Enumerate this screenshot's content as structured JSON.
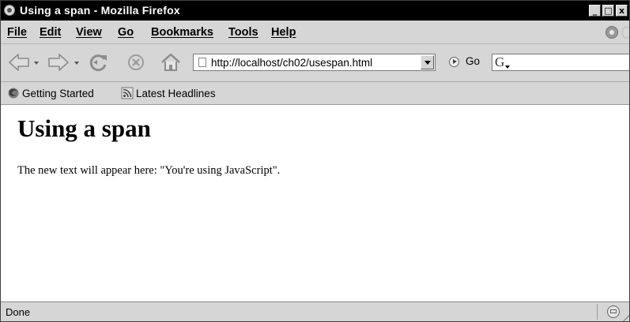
{
  "window": {
    "title": "Using a span - Mozilla Firefox",
    "controls": {
      "minimize": "_",
      "maximize": "□",
      "close": "x"
    }
  },
  "menubar": {
    "items": [
      {
        "label": "File"
      },
      {
        "label": "Edit"
      },
      {
        "label": "View"
      },
      {
        "label": "Go"
      },
      {
        "label": "Bookmarks"
      },
      {
        "label": "Tools"
      },
      {
        "label": "Help"
      }
    ]
  },
  "navbar": {
    "buttons": [
      "back-icon",
      "forward-icon",
      "reload-icon",
      "stop-icon",
      "home-icon"
    ],
    "url": "http://localhost/ch02/usespan.html",
    "go_label": "Go",
    "search_engine_icon": "google-icon",
    "search_value": ""
  },
  "bookmarks": {
    "items": [
      {
        "label": "Getting Started",
        "icon": "firefox-icon"
      },
      {
        "label": "Latest Headlines",
        "icon": "rss-icon"
      }
    ]
  },
  "page": {
    "heading": "Using a span",
    "paragraph": "The new text will appear here: \"You're using JavaScript\"."
  },
  "statusbar": {
    "text": "Done",
    "security_icon": "security-icon"
  }
}
